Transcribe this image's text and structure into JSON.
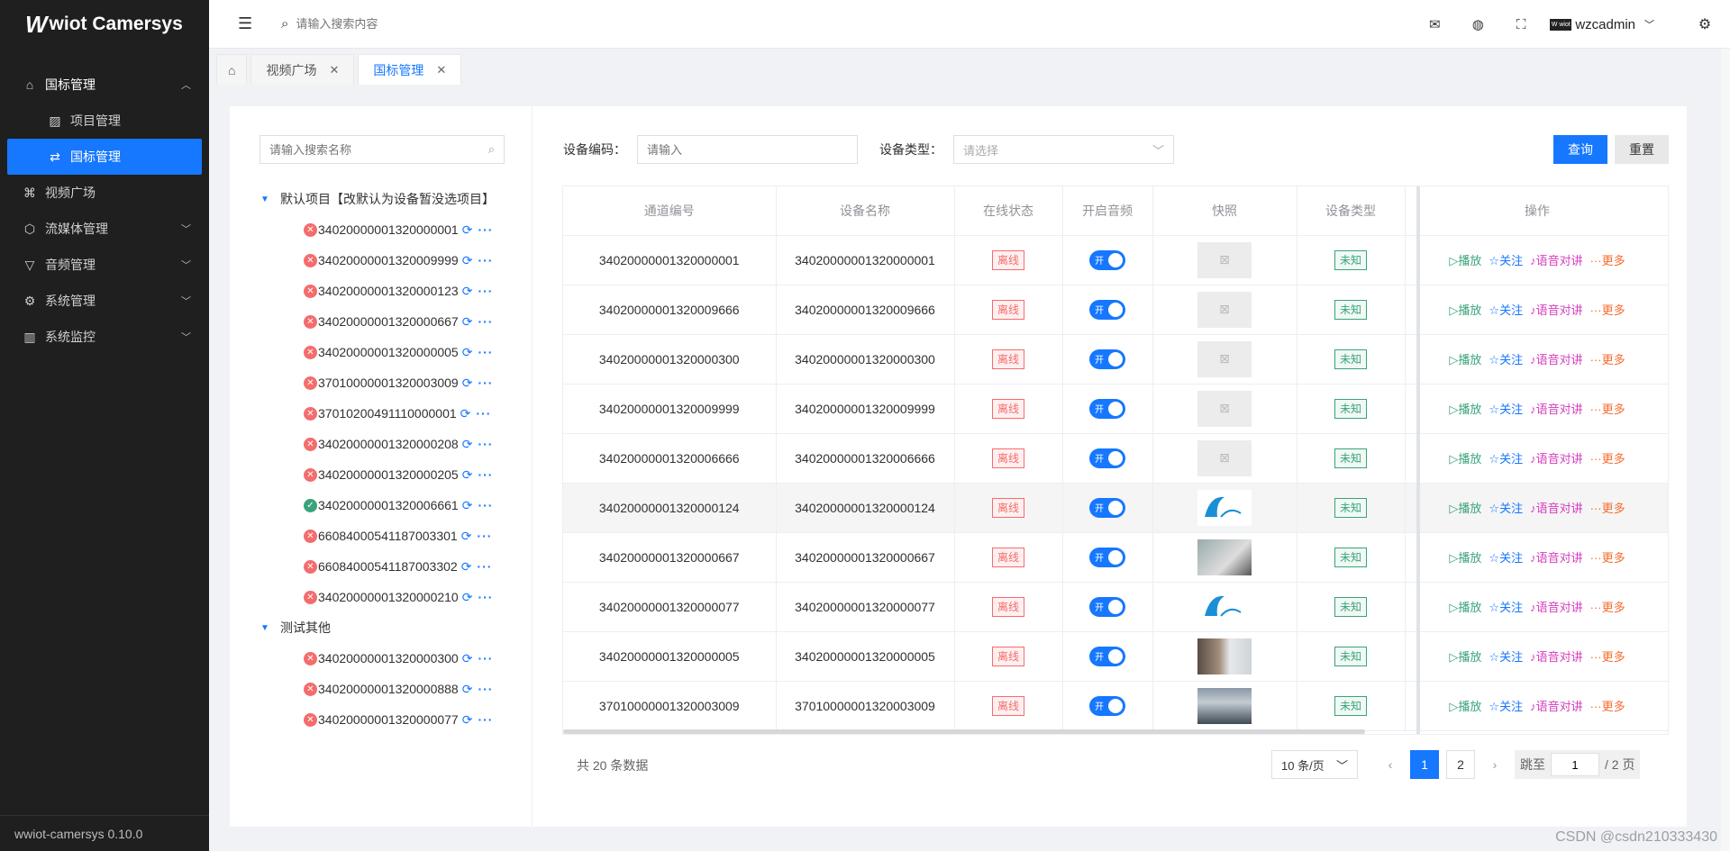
{
  "app": {
    "logo_letter": "W",
    "logo_text": "wiot Camersys",
    "version": "wwiot-camersys 0.10.0"
  },
  "sidebar": {
    "items": [
      {
        "label": "国标管理",
        "icon": "home-gear-icon",
        "expanded": true
      },
      {
        "label": "项目管理",
        "icon": "image-icon",
        "sub": true
      },
      {
        "label": "国标管理",
        "icon": "swap-icon",
        "sub": true,
        "active": true
      },
      {
        "label": "视频广场",
        "icon": "command-icon"
      },
      {
        "label": "流媒体管理",
        "icon": "chip-icon"
      },
      {
        "label": "音频管理",
        "icon": "filter-icon"
      },
      {
        "label": "系统管理",
        "icon": "gear-icon"
      },
      {
        "label": "系统监控",
        "icon": "bar-chart-icon"
      }
    ]
  },
  "header": {
    "search_placeholder": "请输入搜索内容",
    "username": "wzcadmin",
    "avatar_text": "W wiot"
  },
  "tabs": [
    {
      "label": "",
      "icon": "home-icon"
    },
    {
      "label": "视频广场",
      "closable": true
    },
    {
      "label": "国标管理",
      "closable": true,
      "active": true
    }
  ],
  "tree": {
    "search_placeholder": "请输入搜索名称",
    "groups": [
      {
        "label": "默认项目【改默认为设备暂没选项目】",
        "devices": [
          {
            "id": "34020000001320000001",
            "online": false
          },
          {
            "id": "34020000001320009999",
            "online": false
          },
          {
            "id": "34020000001320000123",
            "online": false
          },
          {
            "id": "34020000001320000667",
            "online": false
          },
          {
            "id": "34020000001320000005",
            "online": false
          },
          {
            "id": "37010000001320003009",
            "online": false
          },
          {
            "id": "37010200491110000001",
            "online": false
          },
          {
            "id": "34020000001320000208",
            "online": false
          },
          {
            "id": "34020000001320000205",
            "online": false
          },
          {
            "id": "34020000001320006661",
            "online": true
          },
          {
            "id": "66084000541187003301",
            "online": false
          },
          {
            "id": "66084000541187003302",
            "online": false
          },
          {
            "id": "34020000001320000210",
            "online": false
          }
        ]
      },
      {
        "label": "测试其他",
        "devices": [
          {
            "id": "34020000001320000300",
            "online": false
          },
          {
            "id": "34020000001320000888",
            "online": false
          },
          {
            "id": "34020000001320000077",
            "online": false
          }
        ]
      }
    ]
  },
  "filters": {
    "code_label": "设备编码：",
    "code_placeholder": "请输入",
    "type_label": "设备类型：",
    "type_placeholder": "请选择",
    "query_label": "查询",
    "reset_label": "重置"
  },
  "table": {
    "columns": [
      "通道编号",
      "设备名称",
      "在线状态",
      "开启音频",
      "快照",
      "设备类型",
      "操作"
    ],
    "action_labels": {
      "play": "播放",
      "follow": "关注",
      "talk": "语音对讲",
      "more": "更多"
    },
    "rows": [
      {
        "channel": "34020000001320000001",
        "name": "34020000001320000001",
        "status": "离线",
        "audio": "开",
        "snapshot": "empty",
        "type": "未知"
      },
      {
        "channel": "34020000001320009666",
        "name": "34020000001320009666",
        "status": "离线",
        "audio": "开",
        "snapshot": "empty",
        "type": "未知"
      },
      {
        "channel": "34020000001320000300",
        "name": "34020000001320000300",
        "status": "离线",
        "audio": "开",
        "snapshot": "empty",
        "type": "未知"
      },
      {
        "channel": "34020000001320009999",
        "name": "34020000001320009999",
        "status": "离线",
        "audio": "开",
        "snapshot": "empty",
        "type": "未知"
      },
      {
        "channel": "34020000001320006666",
        "name": "34020000001320006666",
        "status": "离线",
        "audio": "开",
        "snapshot": "empty",
        "type": "未知"
      },
      {
        "channel": "34020000001320000124",
        "name": "34020000001320000124",
        "status": "离线",
        "audio": "开",
        "snapshot": "zlm",
        "type": "未知",
        "highlight": true
      },
      {
        "channel": "34020000001320000667",
        "name": "34020000001320000667",
        "status": "离线",
        "audio": "开",
        "snapshot": "cam",
        "type": "未知"
      },
      {
        "channel": "34020000001320000077",
        "name": "34020000001320000077",
        "status": "离线",
        "audio": "开",
        "snapshot": "zlm",
        "type": "未知"
      },
      {
        "channel": "34020000001320000005",
        "name": "34020000001320000005",
        "status": "离线",
        "audio": "开",
        "snapshot": "cam2",
        "type": "未知"
      },
      {
        "channel": "37010000001320003009",
        "name": "37010000001320003009",
        "status": "离线",
        "audio": "开",
        "snapshot": "cam3",
        "type": "未知"
      }
    ]
  },
  "pagination": {
    "total_text": "共 20 条数据",
    "page_size": "10 条/页",
    "pages": [
      "1",
      "2"
    ],
    "current": "1",
    "jump_label": "跳至",
    "jump_value": "1",
    "total_pages_text": "/ 2 页"
  },
  "watermark": "CSDN @csdn210333430",
  "colors": {
    "sidebar_bg": "#1f1f1f",
    "accent": "#1677ff",
    "offline": "#f56c6c",
    "online": "#3aa37a"
  }
}
